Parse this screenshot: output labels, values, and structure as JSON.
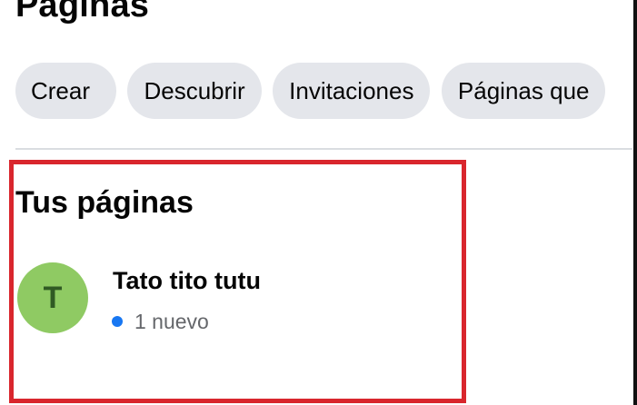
{
  "header": {
    "title": "Páginas"
  },
  "tabs": [
    {
      "label": "Crear"
    },
    {
      "label": "Descubrir"
    },
    {
      "label": "Invitaciones"
    },
    {
      "label": "Páginas que"
    }
  ],
  "your_pages": {
    "title": "Tus páginas",
    "items": [
      {
        "avatar_letter": "T",
        "name": "Tato tito tutu",
        "status": "1 nuevo",
        "status_dot_color": "#1877f2",
        "avatar_color": "#8fca63"
      }
    ]
  },
  "colors": {
    "chip_background": "#e4e6eb",
    "highlight_border": "#d9262d",
    "secondary_text": "#65676b"
  }
}
